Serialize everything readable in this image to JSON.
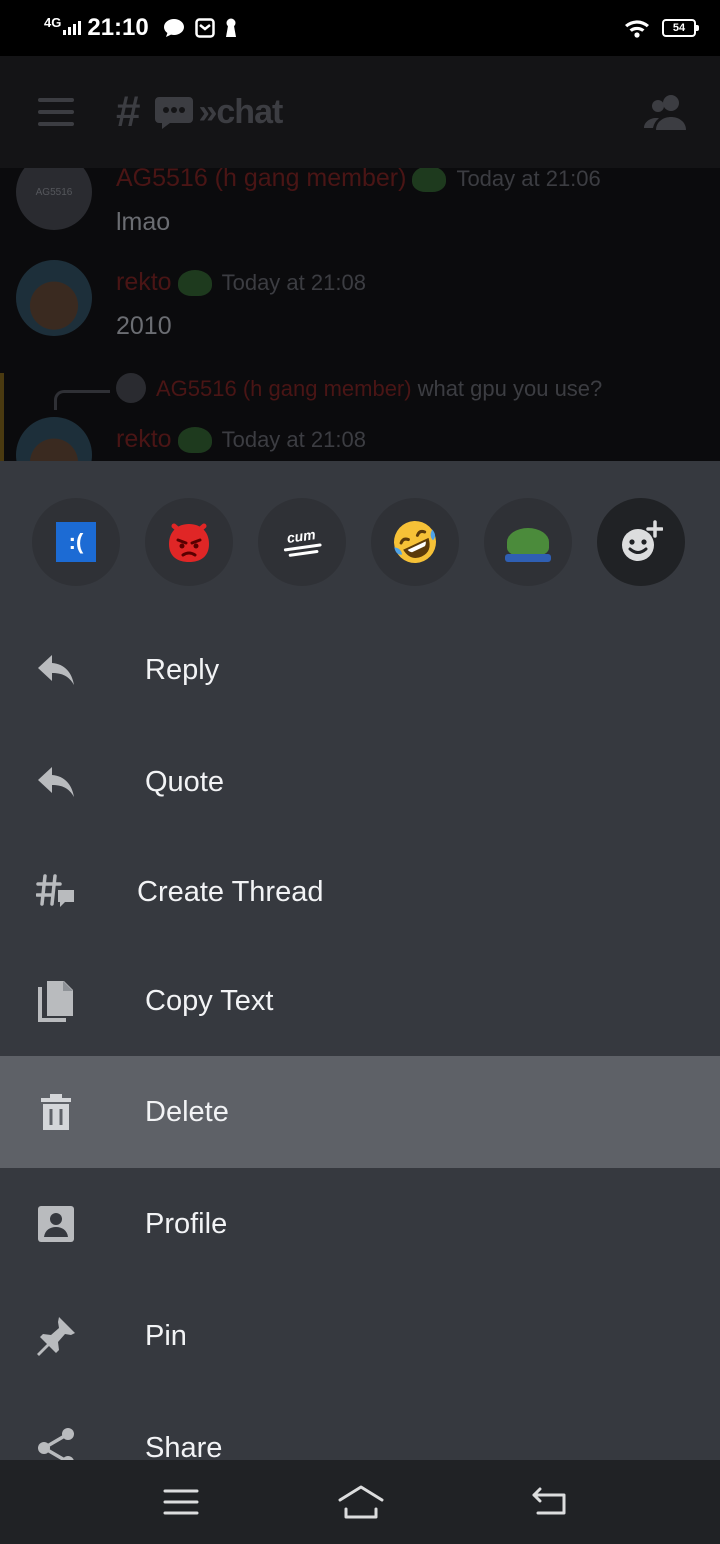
{
  "status_bar": {
    "network": "4G",
    "time": "21:10",
    "battery": "54"
  },
  "channel_header": {
    "channel_name": "»chat"
  },
  "messages": [
    {
      "author": "AG5516 (h gang member)",
      "timestamp": "Today at 21:06",
      "text": "lmao",
      "avatar_text": "AG5516"
    },
    {
      "author": "rekto",
      "timestamp": "Today at 21:08",
      "text": "2010"
    },
    {
      "reply_to_author": "AG5516 (h gang member)",
      "reply_to_text": "what gpu you use?",
      "author": "rekto",
      "timestamp": "Today at 21:08"
    }
  ],
  "reactions": [
    {
      "icon": "sad-windows-emoji",
      "text": ":("
    },
    {
      "icon": "angry-face-emoji"
    },
    {
      "icon": "cum-text-emoji",
      "text": "cum"
    },
    {
      "icon": "rolling-laughing-emoji"
    },
    {
      "icon": "pepe-frog-emoji"
    },
    {
      "icon": "add-reaction-icon"
    }
  ],
  "menu": {
    "items": [
      {
        "label": "Reply",
        "icon": "reply-icon"
      },
      {
        "label": "Quote",
        "icon": "quote-icon"
      },
      {
        "label": "Create Thread",
        "icon": "create-thread-icon"
      },
      {
        "label": "Copy Text",
        "icon": "copy-icon"
      },
      {
        "label": "Delete",
        "icon": "trash-icon",
        "selected": true
      },
      {
        "label": "Profile",
        "icon": "profile-icon"
      },
      {
        "label": "Pin",
        "icon": "pin-icon"
      },
      {
        "label": "Share",
        "icon": "share-icon"
      }
    ]
  },
  "colors": {
    "sheet_background": "#36393f",
    "selected_row": "#5e6167",
    "text": "#f2f3f5",
    "icon": "#b9bbbe"
  }
}
